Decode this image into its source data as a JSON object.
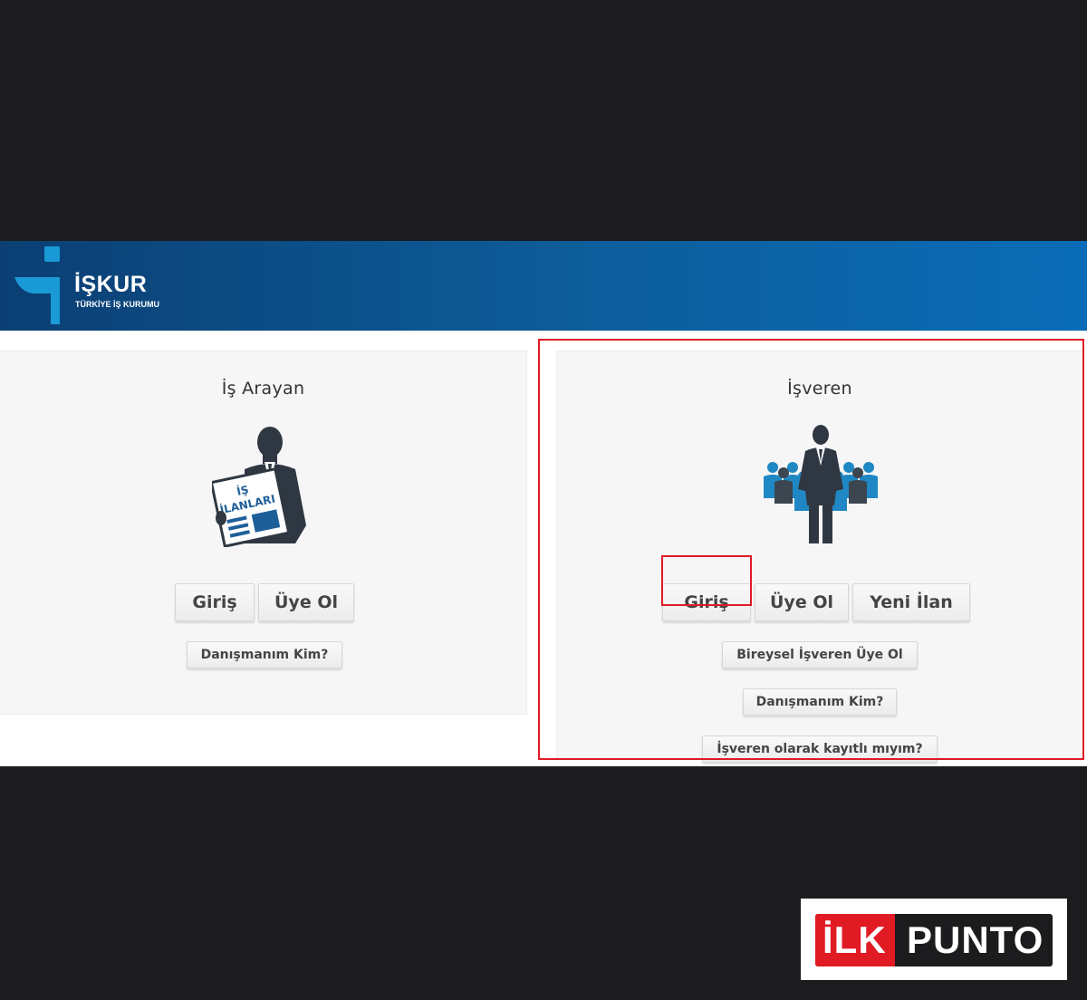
{
  "header": {
    "logo_title": "İŞKUR",
    "logo_subtitle": "TÜRKİYE İŞ KURUMU"
  },
  "job_seeker": {
    "title": "İş Arayan",
    "newspaper_text_line1": "İŞ",
    "newspaper_text_line2": "İLANLARI",
    "login_label": "Giriş",
    "register_label": "Üye Ol",
    "advisor_label": "Danışmanım Kim?"
  },
  "employer": {
    "title": "İşveren",
    "login_label": "Giriş",
    "register_label": "Üye Ol",
    "new_listing_label": "Yeni İlan",
    "individual_register_label": "Bireysel İşveren Üye Ol",
    "advisor_label": "Danışmanım Kim?",
    "registered_check_label": "İşveren olarak kayıtlı mıyım?"
  },
  "watermark": {
    "brand_part1": "İLK",
    "brand_part2": "PUNTO"
  },
  "colors": {
    "header_dark": "#0b3f73",
    "header_light": "#0a6cb6",
    "logo_accent": "#1a9ad6",
    "highlight": "#e01b24",
    "figure_dark": "#2f3842",
    "figure_blue": "#1f88c4",
    "page_background": "#1c1b1d"
  }
}
